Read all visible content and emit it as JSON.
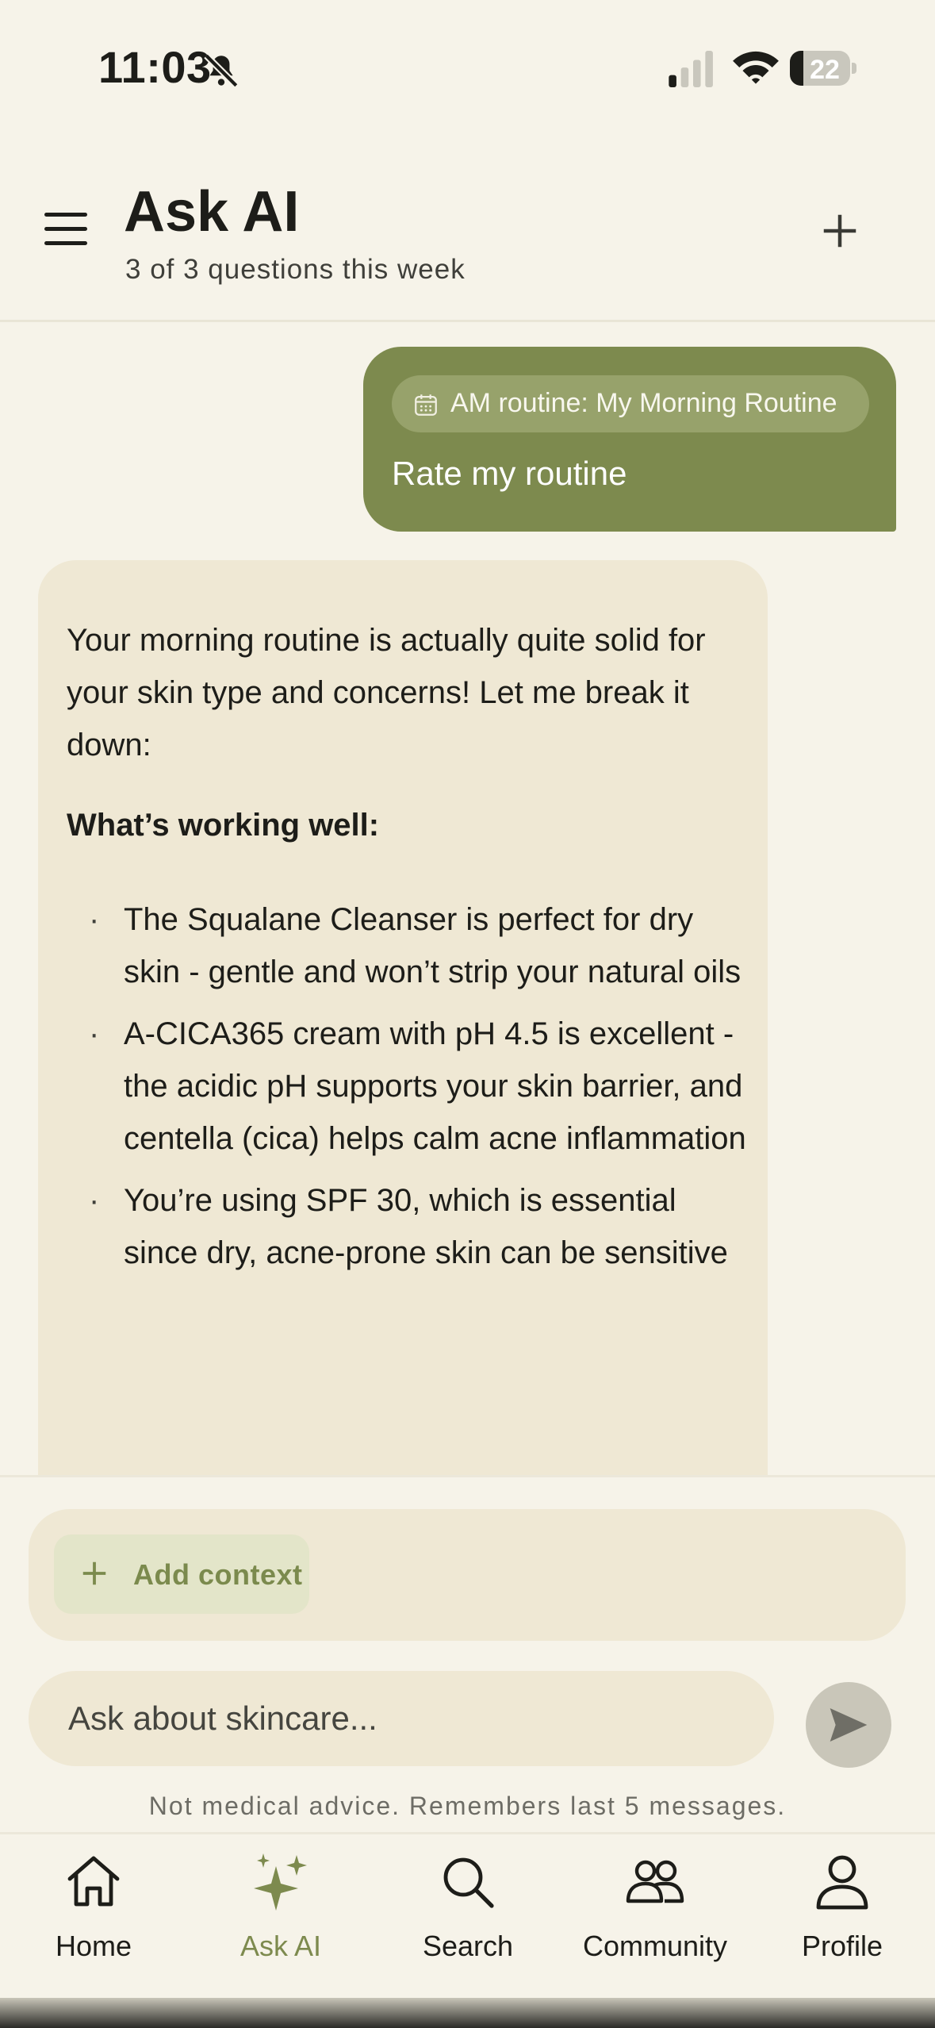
{
  "status_bar": {
    "time": "11:03",
    "battery_level": "22",
    "battery_fraction": 0.22
  },
  "header": {
    "title": "Ask AI",
    "subtitle": "3 of 3 questions this week"
  },
  "chat": {
    "user_message": {
      "context_chip": "AM routine: My Morning Routine",
      "text": "Rate my routine"
    },
    "ai_message": {
      "intro": "Your morning routine is actually quite solid for your skin type and concerns! Let me break it down:",
      "heading": "What’s working well:",
      "bullets": [
        "The Squalane Cleanser is perfect for dry skin - gentle and won’t strip your natural oils",
        "A-CICA365 cream with pH 4.5 is excellent - the acidic pH supports your skin barrier, and centella (cica) helps calm acne inflammation",
        "You’re using SPF 30, which is essential since dry, acne-prone skin can be sensitive"
      ]
    }
  },
  "composer": {
    "add_context_label": "Add context",
    "input_placeholder": "Ask about skincare...",
    "disclaimer": "Not medical advice. Remembers last 5 messages."
  },
  "tab_bar": {
    "active_tab": "Ask AI",
    "accent_color": "#7d8a4e",
    "tabs": [
      {
        "label": "Home",
        "icon": "home-icon"
      },
      {
        "label": "Ask AI",
        "icon": "sparkle-icon"
      },
      {
        "label": "Search",
        "icon": "search-icon"
      },
      {
        "label": "Community",
        "icon": "community-icon"
      },
      {
        "label": "Profile",
        "icon": "profile-icon"
      }
    ]
  },
  "colors": {
    "background": "#f6f3e9",
    "user_bubble": "#7d8a4e",
    "ai_bubble": "#efe8d4"
  }
}
